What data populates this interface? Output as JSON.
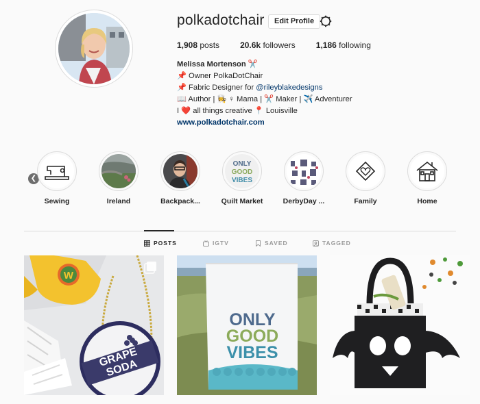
{
  "profile": {
    "username": "polkadotchair",
    "edit_label": "Edit Profile",
    "stats": [
      {
        "count": "1,908",
        "label": "posts"
      },
      {
        "count": "20.6k",
        "label": "followers"
      },
      {
        "count": "1,186",
        "label": "following"
      }
    ],
    "bio": {
      "name": "Melissa Mortenson",
      "name_emoji": "✂️",
      "line1_emoji": "📌",
      "line1": "Owner PolkaDotChair",
      "line2_emoji": "📌",
      "line2_prefix": "Fabric Designer for",
      "line2_mention": "@rileyblakedesigns",
      "line3": "📖  Author | 👩‍🍳 ♀ Mama | ✂️  Maker | ✈️  Adventurer",
      "line4": "I ❤️  all things creative 📍  Louisville",
      "website": "www.polkadotchair.com"
    }
  },
  "highlights": [
    {
      "label": "Sewing",
      "icon": "sewing-machine-icon"
    },
    {
      "label": "Ireland",
      "icon": "landscape-photo"
    },
    {
      "label": "Backpack...",
      "icon": "person-photo"
    },
    {
      "label": "Quilt Market",
      "icon": "only-good-vibes-photo"
    },
    {
      "label": "DerbyDay ...",
      "icon": "derby-photo"
    },
    {
      "label": "Family",
      "icon": "heart-diamond-icon"
    },
    {
      "label": "Home",
      "icon": "house-icon"
    }
  ],
  "tabs": [
    {
      "label": "POSTS",
      "icon": "grid-icon",
      "active": true
    },
    {
      "label": "IGTV",
      "icon": "igtv-icon",
      "active": false
    },
    {
      "label": "SAVED",
      "icon": "bookmark-icon",
      "active": false
    },
    {
      "label": "TAGGED",
      "icon": "tagged-icon",
      "active": false
    }
  ],
  "posts": [
    {
      "alt_icon": "multi-image-icon",
      "text": [
        "GRAPE",
        "SODA"
      ],
      "badge": "W"
    },
    {
      "text": [
        "ONLY",
        "GOOD",
        "VIBES"
      ]
    },
    {
      "text": []
    }
  ],
  "colors": {
    "link": "#003569",
    "text": "#262626",
    "muted": "#999999",
    "border": "#dbdbdb",
    "background": "#fafafa"
  }
}
